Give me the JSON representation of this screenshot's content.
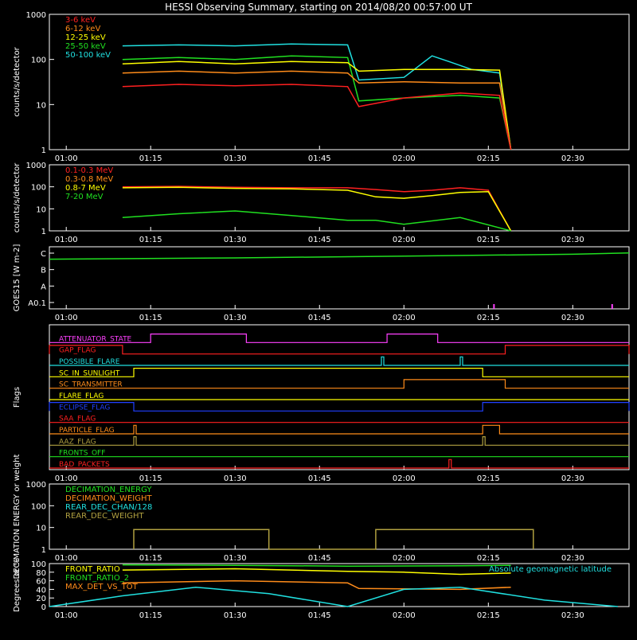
{
  "title": "HESSI Observing Summary, starting on 2014/08/20 00:57:00 UT",
  "time_ticks": [
    "01:00",
    "01:15",
    "01:30",
    "01:45",
    "02:00",
    "02:15",
    "02:30"
  ],
  "colors": {
    "bg": "#000000",
    "fg": "#ffffff",
    "red": "#ff2020",
    "orange": "#ff8c1a",
    "yellow": "#ffff00",
    "green": "#20e020",
    "cyan": "#20e0e0",
    "magenta": "#ff40ff",
    "blue": "#2040ff",
    "olive": "#b0a040"
  },
  "chart_data": [
    {
      "id": "hxr",
      "type": "line",
      "ylabel": "counts/s/detector",
      "yscale": "log",
      "ylim": [
        1,
        1000
      ],
      "y_ticks": [
        "1",
        "10",
        "100",
        "1000"
      ],
      "legend": [
        {
          "label": "3-6 keV",
          "color": "#ff2020"
        },
        {
          "label": "6-12 keV",
          "color": "#ff8c1a"
        },
        {
          "label": "12-25 keV",
          "color": "#ffff00"
        },
        {
          "label": "25-50 keV",
          "color": "#20e020"
        },
        {
          "label": "50-100 keV",
          "color": "#20e0e0"
        }
      ],
      "series": [
        {
          "color": "#20e0e0",
          "x": [
            "01:10",
            "01:20",
            "01:30",
            "01:40",
            "01:50",
            "01:52",
            "02:00",
            "02:05",
            "02:08",
            "02:12",
            "02:17",
            "02:19"
          ],
          "y": [
            200,
            210,
            200,
            220,
            210,
            35,
            40,
            120,
            90,
            60,
            50,
            1
          ]
        },
        {
          "color": "#20e020",
          "x": [
            "01:10",
            "01:20",
            "01:30",
            "01:40",
            "01:50",
            "01:52",
            "02:00",
            "02:10",
            "02:17",
            "02:19"
          ],
          "y": [
            100,
            110,
            100,
            120,
            110,
            12,
            14,
            16,
            14,
            1
          ]
        },
        {
          "color": "#ffff00",
          "x": [
            "01:10",
            "01:20",
            "01:30",
            "01:40",
            "01:50",
            "01:52",
            "02:00",
            "02:10",
            "02:17",
            "02:19"
          ],
          "y": [
            80,
            90,
            80,
            90,
            85,
            55,
            60,
            60,
            58,
            1
          ]
        },
        {
          "color": "#ff8c1a",
          "x": [
            "01:10",
            "01:20",
            "01:30",
            "01:40",
            "01:50",
            "01:52",
            "02:00",
            "02:10",
            "02:17",
            "02:19"
          ],
          "y": [
            50,
            55,
            50,
            55,
            50,
            30,
            32,
            30,
            30,
            1
          ]
        },
        {
          "color": "#ff2020",
          "x": [
            "01:10",
            "01:20",
            "01:30",
            "01:40",
            "01:50",
            "01:52",
            "02:00",
            "02:10",
            "02:17",
            "02:19"
          ],
          "y": [
            25,
            28,
            26,
            28,
            25,
            9,
            14,
            18,
            16,
            1
          ]
        }
      ]
    },
    {
      "id": "gamma",
      "type": "line",
      "ylabel": "counts/s/detector",
      "yscale": "log",
      "ylim": [
        1,
        1000
      ],
      "y_ticks": [
        "1",
        "10",
        "100",
        "1000"
      ],
      "legend": [
        {
          "label": "0.1-0.3 MeV",
          "color": "#ff2020"
        },
        {
          "label": "0.3-0.8 MeV",
          "color": "#ff8c1a"
        },
        {
          "label": "0.8-7 MeV",
          "color": "#ffff00"
        },
        {
          "label": "7-20 MeV",
          "color": "#20e020"
        }
      ],
      "series": [
        {
          "color": "#ff2020",
          "x": [
            "01:10",
            "01:20",
            "01:30",
            "01:40",
            "01:50",
            "01:55",
            "02:00",
            "02:05",
            "02:10",
            "02:15",
            "02:19"
          ],
          "y": [
            100,
            105,
            95,
            90,
            90,
            75,
            60,
            70,
            90,
            70,
            1
          ]
        },
        {
          "color": "#ffff00",
          "x": [
            "01:10",
            "01:20",
            "01:30",
            "01:40",
            "01:50",
            "01:55",
            "02:00",
            "02:05",
            "02:10",
            "02:15",
            "02:19"
          ],
          "y": [
            90,
            95,
            85,
            80,
            70,
            35,
            30,
            40,
            55,
            60,
            1
          ]
        },
        {
          "color": "#20e020",
          "x": [
            "01:10",
            "01:20",
            "01:30",
            "01:40",
            "01:50",
            "01:55",
            "02:00",
            "02:10",
            "02:19"
          ],
          "y": [
            4,
            6,
            8,
            5,
            3,
            3,
            2,
            4,
            1
          ]
        }
      ]
    },
    {
      "id": "goes",
      "type": "line",
      "ylabel": "GOES15 [W m-2]",
      "y_ticks": [
        "A0.1",
        "A",
        "B",
        "C"
      ],
      "series": [
        {
          "color": "#20e020",
          "x": [
            "00:57",
            "01:30",
            "02:00",
            "02:30",
            "02:40"
          ],
          "y": [
            0.8,
            0.82,
            0.85,
            0.88,
            0.9
          ]
        }
      ],
      "spikes": [
        {
          "color": "#ff40ff",
          "x": [
            "02:16",
            "02:37"
          ]
        }
      ]
    },
    {
      "id": "flags",
      "type": "line",
      "ylabel": "Flags",
      "flags": [
        {
          "label": "ATTENUATOR_STATE",
          "color": "#ff40ff",
          "high": [
            [
              "01:15",
              "01:32"
            ],
            [
              "01:57",
              "02:06"
            ]
          ]
        },
        {
          "label": "GAP_FLAG",
          "color": "#ff2020",
          "high": [
            [
              "00:57",
              "01:10"
            ],
            [
              "02:18",
              "02:40"
            ]
          ]
        },
        {
          "label": "POSSIBLE_FLARE",
          "color": "#20e0e0",
          "high": [
            [
              "01:56",
              "01:56"
            ],
            [
              "02:10",
              "02:10"
            ]
          ]
        },
        {
          "label": "SC_IN_SUNLIGHT",
          "color": "#ffff00",
          "high": [
            [
              "01:12",
              "02:14"
            ]
          ]
        },
        {
          "label": "SC_TRANSMITTER",
          "color": "#ff8c1a",
          "high": [
            [
              "02:00",
              "02:18"
            ]
          ]
        },
        {
          "label": "FLARE_FLAG",
          "color": "#ffff00",
          "high": []
        },
        {
          "label": "ECLIPSE_FLAG",
          "color": "#2040ff",
          "high": [
            [
              "00:57",
              "01:12"
            ],
            [
              "02:14",
              "02:40"
            ]
          ]
        },
        {
          "label": "SAA_FLAG",
          "color": "#ff2020",
          "high": []
        },
        {
          "label": "PARTICLE_FLAG",
          "color": "#ff8c1a",
          "high": [
            [
              "01:12",
              "01:12"
            ],
            [
              "02:14",
              "02:17"
            ]
          ]
        },
        {
          "label": "AAZ_FLAG",
          "color": "#b0a040",
          "high": [
            [
              "01:12",
              "01:12"
            ],
            [
              "02:14",
              "02:14"
            ]
          ]
        },
        {
          "label": "FRONTS_OFF",
          "color": "#20e020",
          "high": []
        },
        {
          "label": "BAD_PACKETS",
          "color": "#ff2020",
          "high": [
            [
              "02:08",
              "02:08"
            ]
          ]
        }
      ]
    },
    {
      "id": "decimation",
      "type": "line",
      "ylabel": "DECIMATION ENERGY or weight",
      "yscale": "log",
      "ylim": [
        1,
        1000
      ],
      "y_ticks": [
        "1",
        "10",
        "100",
        "1000"
      ],
      "legend": [
        {
          "label": "DECIMATION_ENERGY",
          "color": "#20e020"
        },
        {
          "label": "DECIMATION_WEIGHT",
          "color": "#ff8c1a"
        },
        {
          "label": "REAR_DEC_CHAN/128",
          "color": "#20e0e0"
        },
        {
          "label": "REAR_DEC_WEIGHT",
          "color": "#b0a040"
        }
      ],
      "series": [
        {
          "color": "#b0a040",
          "x": [
            "01:12",
            "01:12",
            "01:36",
            "01:36",
            "01:55",
            "01:55",
            "02:23",
            "02:23"
          ],
          "y": [
            1,
            8,
            8,
            1,
            1,
            8,
            8,
            1
          ]
        }
      ]
    },
    {
      "id": "ratios",
      "type": "line",
      "ylabel": "Degrees or %",
      "ylim": [
        0,
        100
      ],
      "y_ticks": [
        "0",
        "20",
        "40",
        "60",
        "80",
        "100"
      ],
      "legend": [
        {
          "label": "FRONT_RATIO",
          "color": "#ffff00"
        },
        {
          "label": "FRONT_RATIO_2",
          "color": "#20e020"
        },
        {
          "label": "MAX_DET_VS_TOT",
          "color": "#ff8c1a"
        }
      ],
      "annotation": {
        "label": "Absolute geomagnetic latitude",
        "color": "#20e0e0"
      },
      "series": [
        {
          "color": "#20e020",
          "x": [
            "01:10",
            "01:30",
            "01:50",
            "02:10",
            "02:19"
          ],
          "y": [
            97,
            96,
            94,
            95,
            96
          ]
        },
        {
          "color": "#ffff00",
          "x": [
            "01:10",
            "01:30",
            "01:50",
            "02:00",
            "02:10",
            "02:19"
          ],
          "y": [
            85,
            88,
            82,
            80,
            75,
            78
          ]
        },
        {
          "color": "#ff8c1a",
          "x": [
            "01:10",
            "01:30",
            "01:50",
            "01:52",
            "02:10",
            "02:19"
          ],
          "y": [
            55,
            60,
            55,
            42,
            40,
            45
          ]
        },
        {
          "color": "#20e0e0",
          "x": [
            "00:57",
            "01:10",
            "01:23",
            "01:36",
            "01:50",
            "02:00",
            "02:10",
            "02:25",
            "02:38"
          ],
          "y": [
            0,
            25,
            45,
            30,
            0,
            40,
            45,
            15,
            0
          ]
        }
      ]
    }
  ]
}
